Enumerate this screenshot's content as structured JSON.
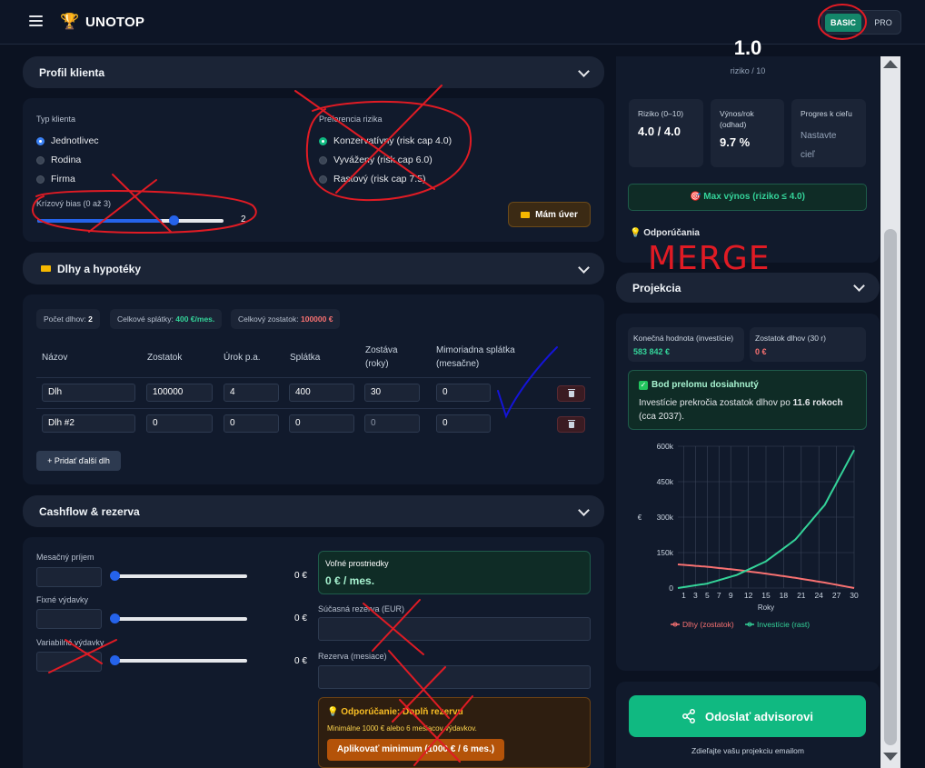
{
  "app": {
    "title": "UNOTOP",
    "plans": {
      "basic": "BASIC",
      "pro": "PRO"
    }
  },
  "profile": {
    "header": "Profil klienta",
    "client_type_label": "Typ klienta",
    "client_types": [
      "Jednotlivec",
      "Rodina",
      "Firma"
    ],
    "selected_client_type": "Jednotlivec",
    "risk_pref_label": "Preferencia rizika",
    "risk_prefs": [
      "Konzervatívny (risk cap 4.0)",
      "Vyvážený (risk cap 6.0)",
      "Rastový (risk cap 7.5)"
    ],
    "selected_risk_pref": "Konzervatívny (risk cap 4.0)",
    "crisis_label": "Krízový bias (0 až 3)",
    "crisis_value": "2",
    "crisis_fraction": 0.667,
    "loan_button": "Mám úver",
    "loan_icon": "card-icon"
  },
  "debts": {
    "header": "Dlhy a hypotéky",
    "summary": {
      "count_label": "Počet dlhov:",
      "count": "2",
      "payments_label": "Celkové splátky:",
      "payments": "400 €/mes.",
      "balance_label": "Celkový zostatok:",
      "balance": "100000 €"
    },
    "columns": [
      "Názov",
      "Zostatok",
      "Úrok p.a.",
      "Splátka",
      "Zostáva (roky)",
      "Mimoriadna splátka (mesačne)"
    ],
    "col_remaining": [
      "Zostáva",
      "(roky)"
    ],
    "col_extra": [
      "Mimoriadna splátka",
      "(mesačne)"
    ],
    "rows": [
      {
        "name": "Dlh",
        "balance": "100000",
        "rate": "4",
        "payment": "400",
        "years": "30",
        "extra": "0"
      },
      {
        "name": "Dlh #2",
        "balance": "0",
        "rate": "0",
        "payment": "0",
        "years": "0",
        "extra": "0"
      }
    ],
    "add_button": "Pridať ďalší dlh"
  },
  "cashflow": {
    "header": "Cashflow & rezerva",
    "income_label": "Mesačný príjem",
    "income_value": "0 €",
    "fixed_label": "Fixné výdavky",
    "fixed_value": "0 €",
    "variable_label": "Variabilné výdavky",
    "variable_value": "0 €",
    "free_label": "Voľné prostriedky",
    "free_value": "0 € / mes.",
    "reserve_label": "Súčasná rezerva (EUR)",
    "reserve_months_label": "Rezerva (mesiace)",
    "tip_title": "Odporúčanie: Doplň rezervu",
    "tip_text": "Minimálne 1000 € alebo 6 mesiacov výdavkov.",
    "tip_button": "Aplikovať minimum (1000 € / 6 mes.)"
  },
  "summary_panel": {
    "score": "1.0",
    "score_sub": "riziko / 10",
    "risk_label": "Riziko (0–10)",
    "risk_value": "4.0 / 4.0",
    "yield_label": [
      "Výnos/rok",
      "(odhad)"
    ],
    "yield_value": "9.7 %",
    "progress_label": "Progres k cieľu",
    "progress_value": [
      "Nastavte",
      "cieľ"
    ],
    "max_yield_button": "Max výnos (riziko ≤ 4.0)",
    "recommendations": "Odporúčania"
  },
  "projection": {
    "header": "Projekcia",
    "final_label": "Konečná hodnota (investície)",
    "final_value": "583 842 €",
    "debt_label": "Zostatok dlhov (30 r)",
    "debt_value": "0 €",
    "breakeven_title": "Bod prelomu dosiahnutý",
    "breakeven_text_a": "Investície prekročia zostatok dlhov po ",
    "breakeven_years": "11.6 rokoch",
    "breakeven_text_b": "(cca 2037)."
  },
  "chart_data": {
    "type": "line",
    "xlabel": "Roky",
    "ylabel": "€",
    "x_ticks": [
      1,
      3,
      5,
      7,
      9,
      12,
      15,
      18,
      21,
      24,
      27,
      30
    ],
    "y_ticks": [
      "0",
      "150k",
      "300k",
      "450k",
      "600k"
    ],
    "ylim": [
      0,
      600000
    ],
    "xlim": [
      0,
      30
    ],
    "series": [
      {
        "name": "Dlhy (zostatok)",
        "color": "#f87171",
        "x": [
          0,
          5,
          10,
          15,
          20,
          25,
          30
        ],
        "values": [
          100000,
          90000,
          77000,
          61000,
          43000,
          23000,
          0
        ]
      },
      {
        "name": "Investície (rast)",
        "color": "#34d399",
        "x": [
          0,
          5,
          10,
          15,
          20,
          25,
          30
        ],
        "values": [
          0,
          19000,
          55000,
          113000,
          205000,
          352000,
          583842
        ]
      }
    ],
    "legend": "bottom"
  },
  "share": {
    "button": "Odoslať advisorovi",
    "caption": "Zdieľajte vašu projekciu emailom"
  },
  "annotations": {
    "merge_text": "MERGE"
  },
  "colors": {
    "accent": "#10b981",
    "brand": "#14876a",
    "danger": "#f87171",
    "annotation_red": "#e01b24",
    "annotation_blue": "#1414d8"
  }
}
